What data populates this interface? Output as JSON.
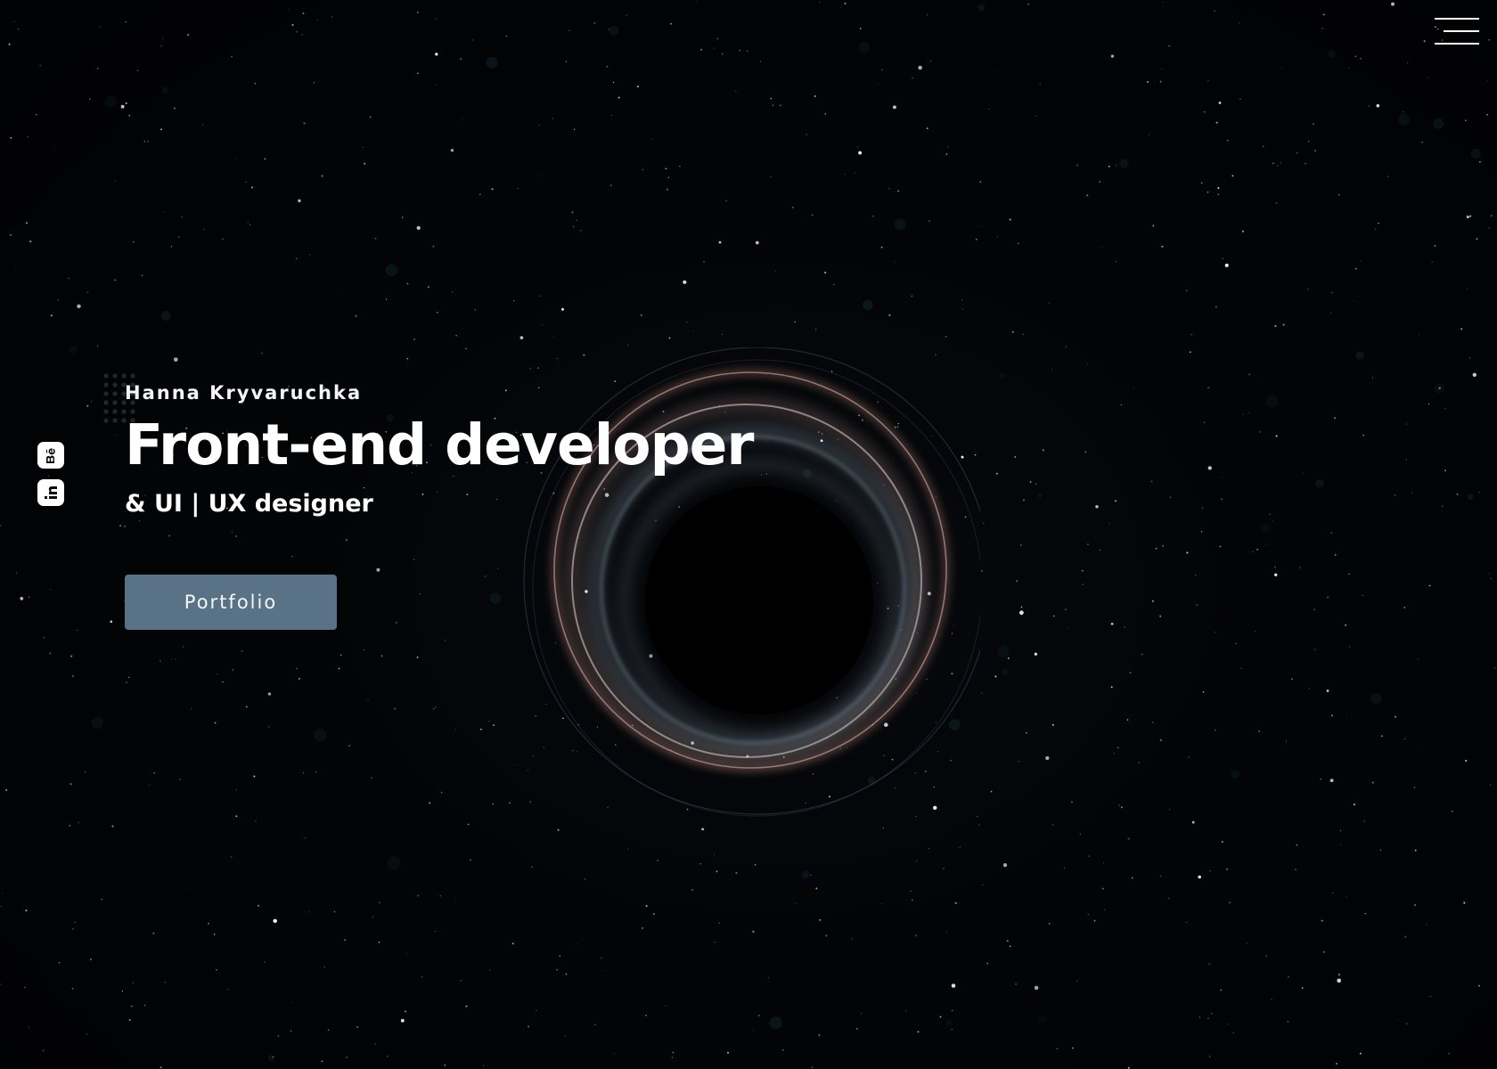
{
  "colors": {
    "background": "#020305",
    "text": "#ffffff",
    "button_background": "#5a7286",
    "button_text": "#f4f7fa",
    "ring_warm": "#c59a92",
    "ring_cool": "#9fb3c4"
  },
  "header": {
    "menu_icon": "hamburger-menu-icon"
  },
  "social_links": [
    {
      "icon": "behance-icon"
    },
    {
      "icon": "linkedin-style-icon"
    }
  ],
  "hero": {
    "name": "Hanna Kryvaruchka",
    "title": "Front-end developer",
    "subtitle": "& UI | UX designer",
    "cta_label": "Portfolio"
  }
}
